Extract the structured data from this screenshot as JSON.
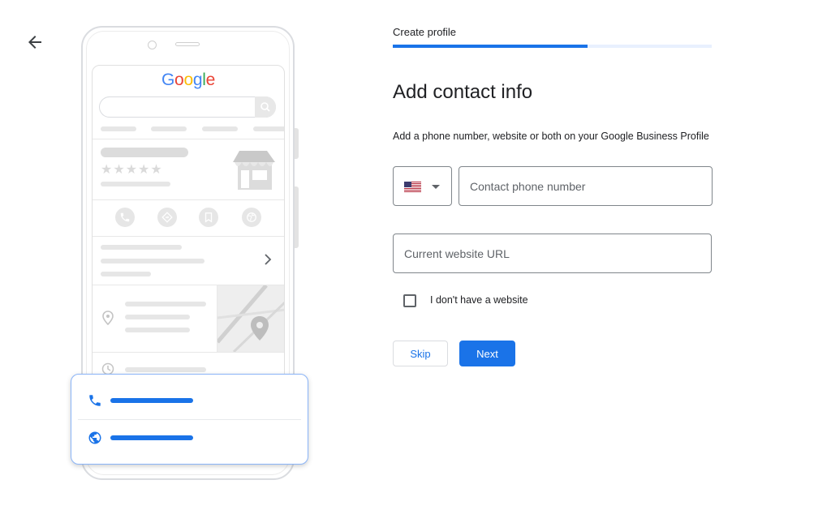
{
  "nav": {
    "back_icon": "arrow-back-icon"
  },
  "illustration": {
    "logo_text": [
      "G",
      "o",
      "o",
      "g",
      "l",
      "e"
    ],
    "logo_colors": [
      "#4285f4",
      "#ea4335",
      "#fbbc05",
      "#4285f4",
      "#34a853",
      "#ea4335"
    ],
    "stars": "★★★★★",
    "accent_color": "#1a73e8"
  },
  "form": {
    "step_label": "Create profile",
    "progress_fraction": 0.61,
    "title": "Add contact info",
    "subtitle": "Add a phone number, website or both on your Google Business Profile",
    "country_flag": "us-flag-icon",
    "phone_placeholder": "Contact phone number",
    "website_placeholder": "Current website URL",
    "no_website_label": "I don't have a website",
    "no_website_checked": false,
    "skip_label": "Skip",
    "next_label": "Next",
    "primary_color": "#1a73e8"
  }
}
